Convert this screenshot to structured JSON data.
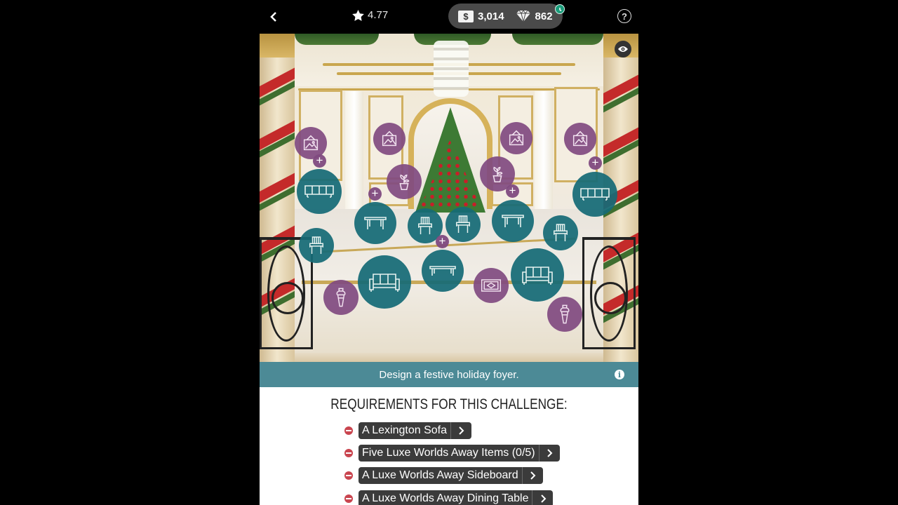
{
  "topbar": {
    "back_icon": "chevron-left-icon",
    "rating": "4.77",
    "rating_icon": "star-icon",
    "cash_symbol": "$",
    "cash": "3,014",
    "gems": "862",
    "gem_icon": "diamond-icon",
    "timer_icon": "clock-icon",
    "help_label": "?"
  },
  "room": {
    "view_icon": "eye-icon",
    "hotspots": [
      {
        "type": "wall-art",
        "color": "purple",
        "icon": "picture-frame-icon"
      },
      {
        "type": "wall-art",
        "color": "purple",
        "icon": "picture-frame-icon"
      },
      {
        "type": "wall-art",
        "color": "purple",
        "icon": "picture-frame-icon"
      },
      {
        "type": "wall-art",
        "color": "purple",
        "icon": "picture-frame-icon"
      },
      {
        "type": "plant",
        "color": "purple",
        "icon": "potted-plant-icon"
      },
      {
        "type": "plant",
        "color": "purple",
        "icon": "potted-plant-icon"
      },
      {
        "type": "sideboard",
        "color": "teal",
        "icon": "sideboard-icon"
      },
      {
        "type": "sideboard",
        "color": "teal",
        "icon": "sideboard-icon"
      },
      {
        "type": "dining-table",
        "color": "teal",
        "icon": "table-icon"
      },
      {
        "type": "dining-table",
        "color": "teal",
        "icon": "table-icon"
      },
      {
        "type": "chair",
        "color": "teal",
        "icon": "chair-icon"
      },
      {
        "type": "chair",
        "color": "teal",
        "icon": "chair-icon"
      },
      {
        "type": "chair",
        "color": "teal",
        "icon": "chair-icon"
      },
      {
        "type": "chair",
        "color": "teal",
        "icon": "chair-icon"
      },
      {
        "type": "sofa",
        "color": "teal",
        "icon": "sofa-icon"
      },
      {
        "type": "sofa",
        "color": "teal",
        "icon": "sofa-icon"
      },
      {
        "type": "coffee-table",
        "color": "teal",
        "icon": "bench-icon"
      },
      {
        "type": "rug",
        "color": "purple",
        "icon": "rug-icon"
      },
      {
        "type": "vase",
        "color": "purple",
        "icon": "vase-icon"
      },
      {
        "type": "vase",
        "color": "purple",
        "icon": "vase-icon"
      }
    ],
    "add_symbol": "+"
  },
  "prompt": {
    "text": "Design a festive holiday foyer.",
    "info_label": "i"
  },
  "requirements": {
    "title": "REQUIREMENTS FOR THIS CHALLENGE:",
    "items": [
      {
        "label": "A Lexington Sofa",
        "status": "incomplete"
      },
      {
        "label": "Five Luxe Worlds Away Items (0/5)",
        "status": "incomplete"
      },
      {
        "label": "A Luxe Worlds Away Sideboard",
        "status": "incomplete"
      },
      {
        "label": "A Luxe Worlds Away Dining Table",
        "status": "incomplete"
      }
    ]
  },
  "colors": {
    "teal_hotspot": "#166a76",
    "purple_hotspot": "#804a80",
    "prompt_bar": "#4c8a96",
    "incomplete": "#c9454f",
    "chip": "#3b3b3b"
  }
}
